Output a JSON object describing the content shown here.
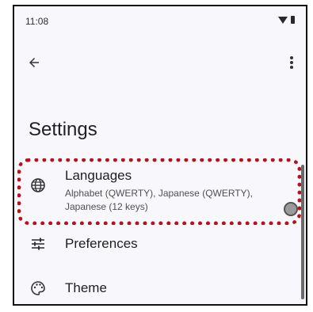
{
  "status_bar": {
    "time": "11:08",
    "icons": [
      "wifi-icon",
      "battery-icon"
    ]
  },
  "top_bar": {
    "back_icon": "arrow-back-icon",
    "more_icon": "more-vert-icon"
  },
  "page": {
    "title": "Settings"
  },
  "items": [
    {
      "icon": "globe-icon",
      "title": "Languages",
      "subtitle": "Alphabet (QWERTY), Japanese (QWERTY), Japanese (12 keys)"
    },
    {
      "icon": "tune-icon",
      "title": "Preferences"
    },
    {
      "icon": "palette-icon",
      "title": "Theme"
    }
  ],
  "colors": {
    "highlight": "#b5121b",
    "background": "#f8f7fc",
    "text": "#1f1f1f"
  }
}
